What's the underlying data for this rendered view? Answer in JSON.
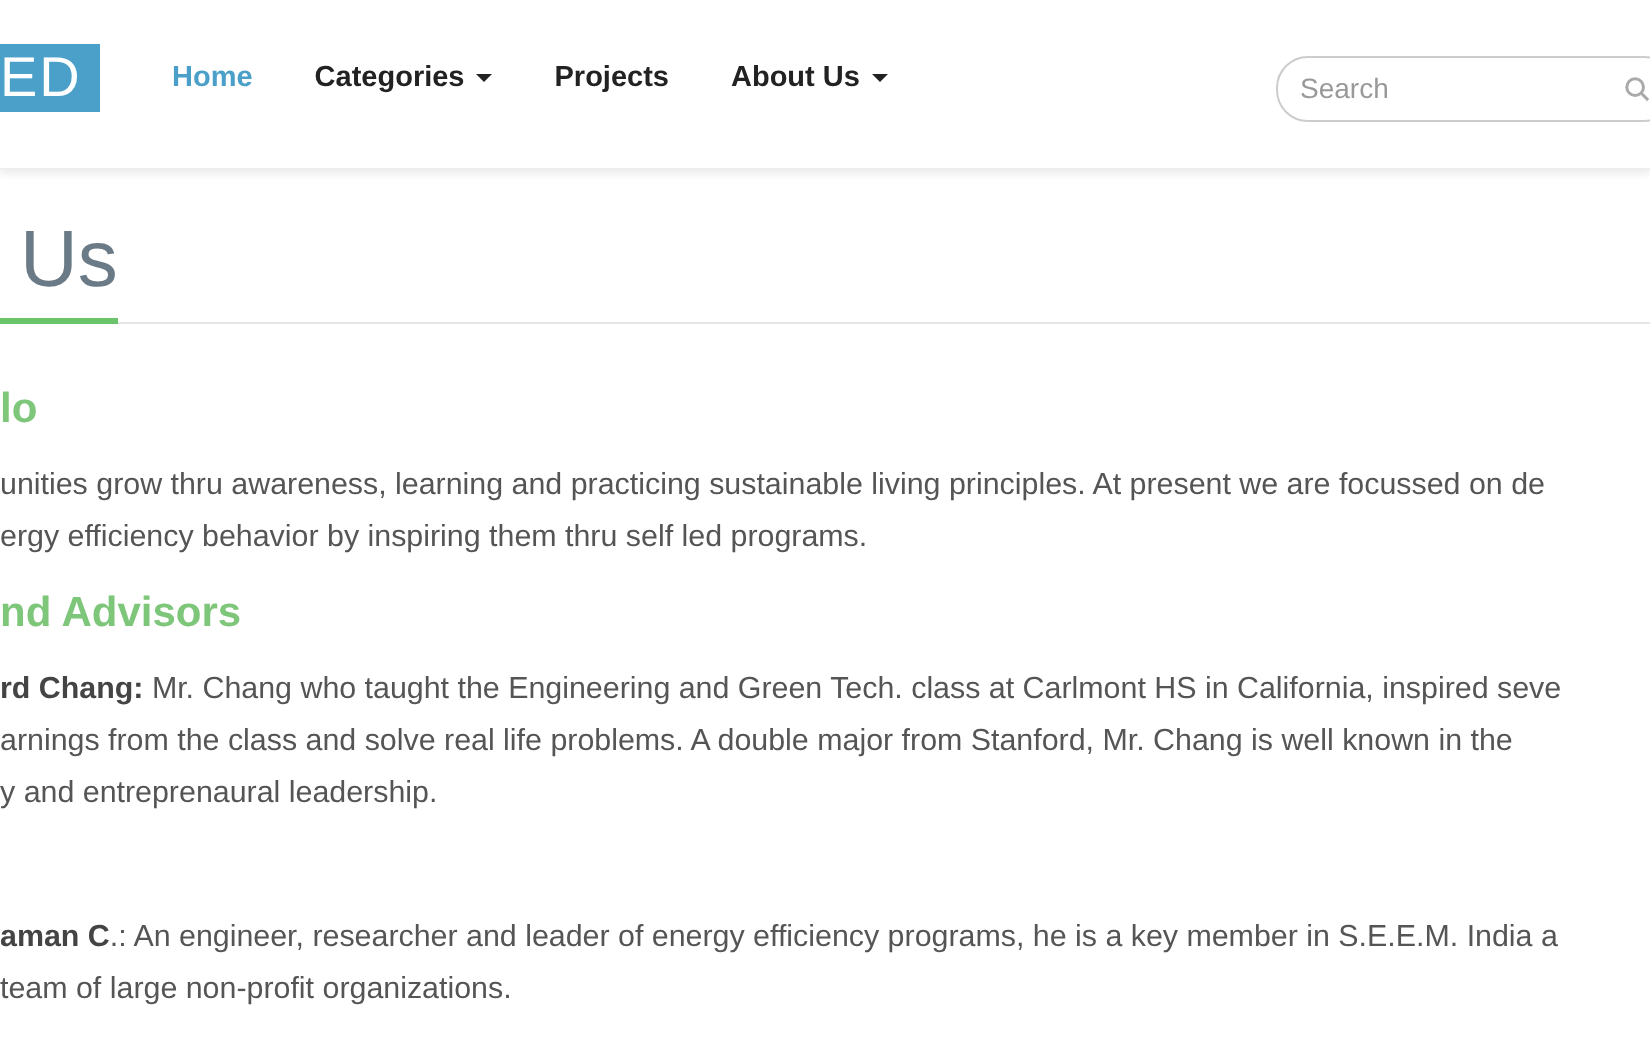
{
  "header": {
    "logo": "ED",
    "nav": [
      {
        "label": "Home",
        "selected": true,
        "dropdown": false
      },
      {
        "label": "Categories",
        "selected": false,
        "dropdown": true
      },
      {
        "label": "Projects",
        "selected": false,
        "dropdown": false
      },
      {
        "label": "About Us",
        "selected": false,
        "dropdown": true
      }
    ],
    "search": {
      "placeholder": "Search"
    }
  },
  "page_title": "Us",
  "sections": [
    {
      "heading": "lo",
      "paragraphs": [
        {
          "lines": [
            "unities grow thru awareness, learning and practicing sustainable living principles. At present we are focussed on de",
            "ergy efficiency behavior by inspiring them thru self led programs."
          ]
        }
      ]
    },
    {
      "heading": "nd Advisors",
      "paragraphs": [
        {
          "lines": [
            "**rd Chang:** Mr. Chang who taught the Engineering and Green Tech. class at Carlmont HS in California, inspired seve",
            "arnings from the class and solve real life problems. A double major from Stanford, Mr. Chang is well known in the",
            "y and entreprenaural leadership."
          ]
        },
        {
          "lines": [
            "**aman C**.: An engineer, researcher and leader of energy efficiency programs, he is a key member in S.E.E.M. India a",
            "team of large non-profit organizations."
          ]
        }
      ]
    }
  ]
}
